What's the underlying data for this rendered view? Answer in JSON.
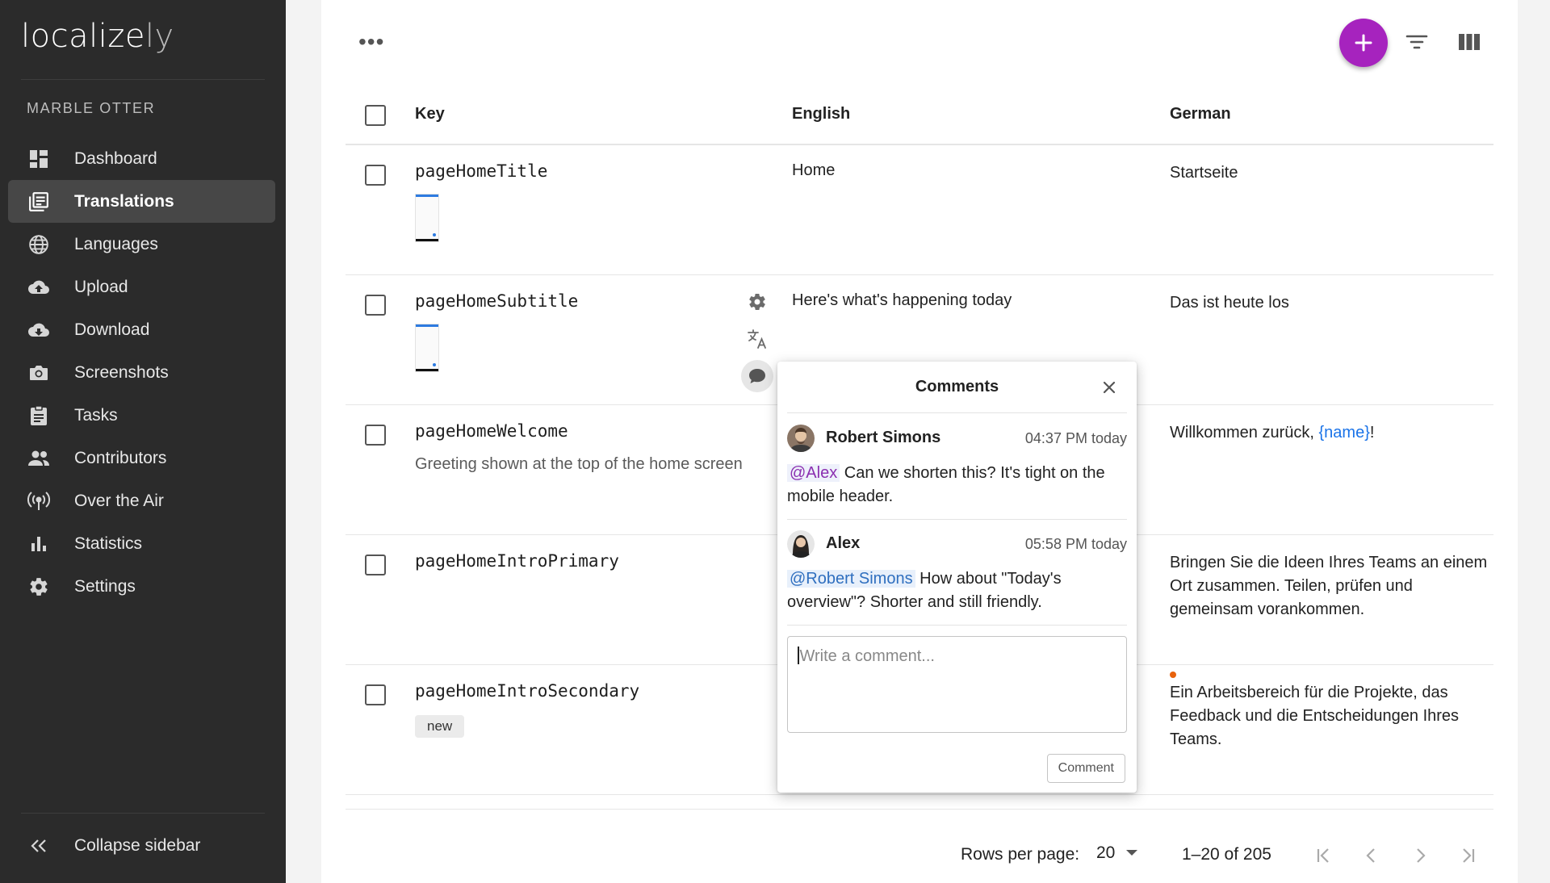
{
  "app": {
    "logo_main": "localize",
    "logo_suffix": "ly",
    "project_name": "MARBLE OTTER"
  },
  "sidebar": {
    "items": [
      {
        "label": "Dashboard",
        "icon": "dashboard-icon"
      },
      {
        "label": "Translations",
        "icon": "translations-icon",
        "active": true
      },
      {
        "label": "Languages",
        "icon": "globe-icon"
      },
      {
        "label": "Upload",
        "icon": "cloud-upload-icon"
      },
      {
        "label": "Download",
        "icon": "cloud-download-icon"
      },
      {
        "label": "Screenshots",
        "icon": "camera-icon"
      },
      {
        "label": "Tasks",
        "icon": "clipboard-icon"
      },
      {
        "label": "Contributors",
        "icon": "people-icon"
      },
      {
        "label": "Over the Air",
        "icon": "antenna-icon"
      },
      {
        "label": "Statistics",
        "icon": "bar-chart-icon"
      },
      {
        "label": "Settings",
        "icon": "gear-icon"
      }
    ],
    "collapse_label": "Collapse sidebar"
  },
  "toolbar": {
    "more_icon": "more-horizontal-icon",
    "add_icon": "plus-icon",
    "filter_icon": "filter-icon",
    "columns_icon": "columns-icon"
  },
  "table": {
    "headers": {
      "key": "Key",
      "english": "English",
      "german": "German"
    },
    "rows": [
      {
        "key": "pageHomeTitle",
        "english": "Home",
        "german": "Startseite"
      },
      {
        "key": "pageHomeSubtitle",
        "english": "Here's what's happening today",
        "german": "Das ist heute los"
      },
      {
        "key": "pageHomeWelcome",
        "description": "Greeting shown at the top of the home screen",
        "english": "",
        "german_before": "Willkommen zurück, ",
        "german_var": "{name}",
        "german_after": "!"
      },
      {
        "key": "pageHomeIntroPrimary",
        "english": "",
        "german": "Bringen Sie die Ideen Ihres Teams an einem Ort zusammen. Teilen, prüfen und gemeinsam vorankommen."
      },
      {
        "key": "pageHomeIntroSecondary",
        "tag": "new",
        "english": "",
        "german": "Ein Arbeitsbereich für die Projekte, das Feedback und die Entscheidungen Ihres Teams."
      }
    ]
  },
  "comments_popover": {
    "title": "Comments",
    "comments": [
      {
        "author": "Robert Simons",
        "time": "04:37 PM today",
        "mention": "@Alex",
        "text": " Can we shorten this? It's tight on the mobile header."
      },
      {
        "author": "Alex",
        "time": "05:58 PM today",
        "mention": "@Robert Simons",
        "text": " How about \"Today's overview\"? Shorter and still friendly."
      }
    ],
    "input_placeholder": "Write a comment...",
    "submit_label": "Comment"
  },
  "pagination": {
    "rows_per_page_label": "Rows per page:",
    "rows_per_page_value": "20",
    "range_label": "1–20 of 205"
  },
  "colors": {
    "accent": "#a623be",
    "sidebar_bg": "#2b2b2b",
    "link": "#1a73e8",
    "unsaved_dot": "#e8620c"
  }
}
